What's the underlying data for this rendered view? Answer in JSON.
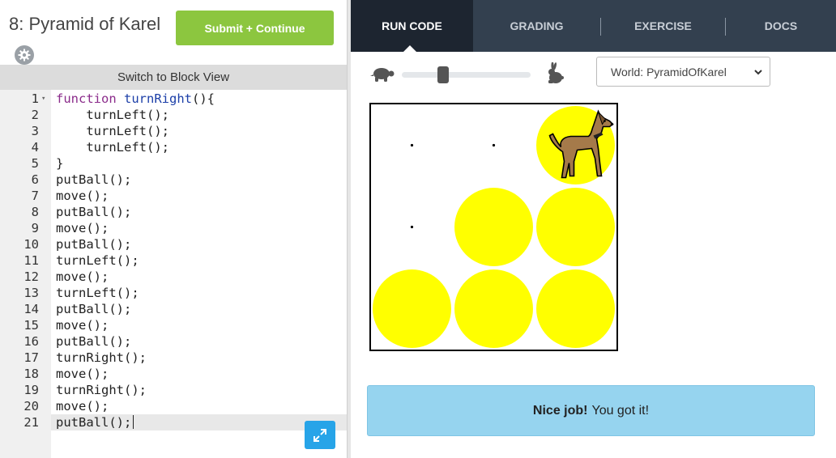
{
  "header": {
    "title": "8: Pyramid of Karel",
    "submit_label": "Submit + Continue"
  },
  "editor": {
    "switch_view_label": "Switch to Block View",
    "lines": [
      {
        "n": "1",
        "text": "function turnRight(){"
      },
      {
        "n": "2",
        "text": "    turnLeft();"
      },
      {
        "n": "3",
        "text": "    turnLeft();"
      },
      {
        "n": "4",
        "text": "    turnLeft();"
      },
      {
        "n": "5",
        "text": "}"
      },
      {
        "n": "6",
        "text": "putBall();"
      },
      {
        "n": "7",
        "text": "move();"
      },
      {
        "n": "8",
        "text": "putBall();"
      },
      {
        "n": "9",
        "text": "move();"
      },
      {
        "n": "10",
        "text": "putBall();"
      },
      {
        "n": "11",
        "text": "turnLeft();"
      },
      {
        "n": "12",
        "text": "move();"
      },
      {
        "n": "13",
        "text": "turnLeft();"
      },
      {
        "n": "14",
        "text": "putBall();"
      },
      {
        "n": "15",
        "text": "move();"
      },
      {
        "n": "16",
        "text": "putBall();"
      },
      {
        "n": "17",
        "text": "turnRight();"
      },
      {
        "n": "18",
        "text": "move();"
      },
      {
        "n": "19",
        "text": "turnRight();"
      },
      {
        "n": "20",
        "text": "move();"
      },
      {
        "n": "21",
        "text": "putBall();"
      }
    ]
  },
  "tabs": [
    {
      "label": "RUN CODE",
      "active": true
    },
    {
      "label": "GRADING",
      "active": false
    },
    {
      "label": "EXERCISE",
      "active": false
    },
    {
      "label": "DOCS",
      "active": false
    }
  ],
  "speed": {
    "slow_icon": "turtle-icon",
    "fast_icon": "rabbit-icon",
    "level": 0.3
  },
  "world_select": {
    "value": "World: PyramidOfKarel"
  },
  "world": {
    "rows": 3,
    "cols": 3,
    "balls": [
      [
        1,
        1
      ],
      [
        1,
        2
      ],
      [
        1,
        3
      ],
      [
        2,
        2
      ],
      [
        2,
        3
      ],
      [
        3,
        3
      ]
    ],
    "empty_dots": [
      [
        3,
        1
      ],
      [
        3,
        2
      ],
      [
        2,
        1
      ]
    ],
    "karel": {
      "row": 3,
      "col": 3,
      "icon": "dog-icon"
    },
    "ball_color": "#ffff00"
  },
  "result": {
    "bold": "Nice job!",
    "text": "You got it!"
  },
  "colors": {
    "submit": "#8cc63f",
    "tab_bar": "#33404f",
    "tab_active": "#1d2530",
    "result_bg": "#96d4ef",
    "expand_button": "#27a4e8"
  }
}
